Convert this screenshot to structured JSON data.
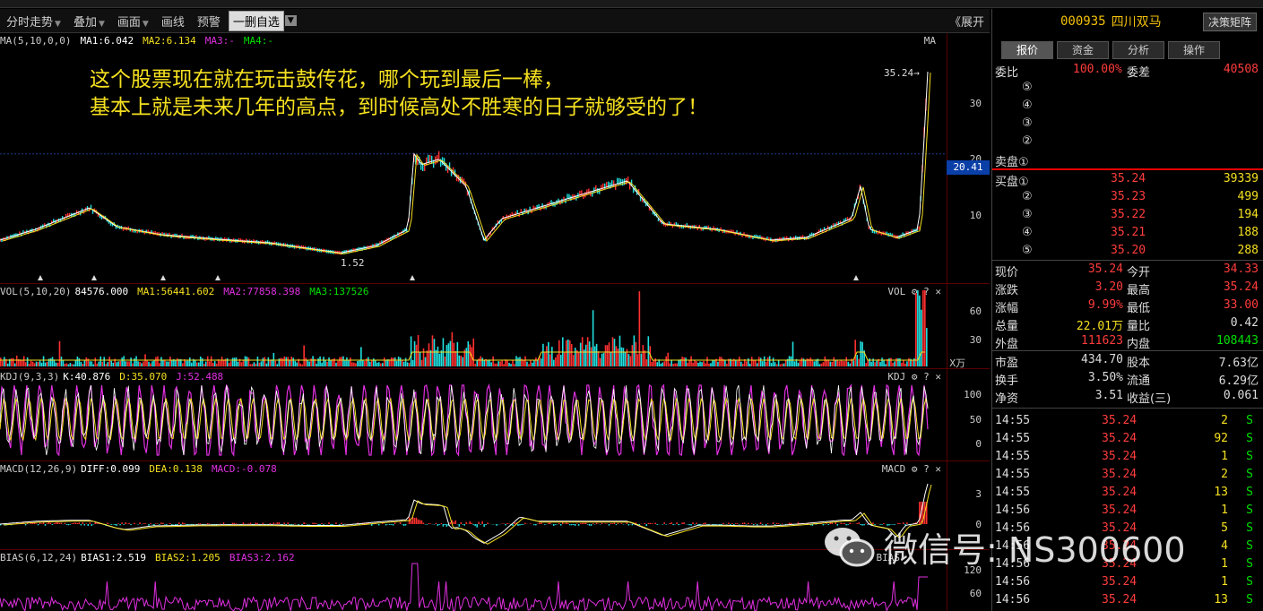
{
  "toolbar": {
    "items": [
      "分时走势",
      "叠加",
      "画面",
      "画线",
      "预警"
    ],
    "selected": "一删自选",
    "expand": "《展开"
  },
  "main_panel": {
    "title": "MA(5,10,0,0)",
    "ma1": "MA1:6.042",
    "ma2": "MA2:6.134",
    "ma3": "MA3:-",
    "ma4": "MA4:-",
    "corner": "MA",
    "high_label": "35.24→",
    "low_label": "1.52",
    "y_ticks": [
      "30",
      "20",
      "10"
    ],
    "current_price": "20.41"
  },
  "annotation": {
    "line1": "这个股票现在就在玩击鼓传花，哪个玩到最后一棒，",
    "line2": "基本上就是未来几年的高点，到时候高处不胜寒的日子就够受的了！"
  },
  "vol_panel": {
    "title": "VOL(5,10,20)",
    "v": "84576.000",
    "ma1": "MA1:56441.602",
    "ma2": "MA2:77858.398",
    "ma3": "MA3:137526",
    "corner": "VOL",
    "y_ticks": [
      "60",
      "30"
    ],
    "unit": "X万"
  },
  "kdj_panel": {
    "title": "KDJ(9,3,3)",
    "k": "K:40.876",
    "d": "D:35.070",
    "j": "J:52.488",
    "corner": "KDJ",
    "y_ticks": [
      "100",
      "50",
      "0"
    ]
  },
  "macd_panel": {
    "title": "MACD(12,26,9)",
    "diff": "DIFF:0.099",
    "dea": "DEA:0.138",
    "macd": "MACD:-0.078",
    "corner": "MACD",
    "y_ticks": [
      "3",
      "0"
    ]
  },
  "bias_panel": {
    "title": "BIAS(6,12,24)",
    "b1": "BIAS1:2.519",
    "b2": "BIAS2:1.205",
    "b3": "BIAS3:2.162",
    "corner": "BIAS",
    "y_ticks": [
      "120",
      "60"
    ]
  },
  "stock": {
    "code": "000935",
    "name": "四川双马",
    "decision_button": "决策矩阵",
    "tabs": [
      "报价",
      "资金",
      "分析",
      "操作"
    ],
    "wei_bi_label": "委比",
    "wei_bi": "100.00%",
    "wei_cha_label": "委差",
    "wei_cha": "40508",
    "sell_levels": [
      "⑤",
      "④",
      "③",
      "②",
      "卖盘①"
    ],
    "buy": [
      {
        "lvl": "买盘①",
        "price": "35.24",
        "vol": "39339"
      },
      {
        "lvl": "②",
        "price": "35.23",
        "vol": "499"
      },
      {
        "lvl": "③",
        "price": "35.22",
        "vol": "194"
      },
      {
        "lvl": "④",
        "price": "35.21",
        "vol": "188"
      },
      {
        "lvl": "⑤",
        "price": "35.20",
        "vol": "288"
      }
    ],
    "quotes": [
      {
        "l1": "现价",
        "v1": "35.24",
        "c1": "red",
        "l2": "今开",
        "v2": "34.33",
        "c2": "red"
      },
      {
        "l1": "涨跌",
        "v1": "3.20",
        "c1": "red",
        "l2": "最高",
        "v2": "35.24",
        "c2": "red"
      },
      {
        "l1": "涨幅",
        "v1": "9.99%",
        "c1": "red",
        "l2": "最低",
        "v2": "33.00",
        "c2": "red"
      },
      {
        "l1": "总量",
        "v1": "22.01万",
        "c1": "yel",
        "l2": "量比",
        "v2": "0.42",
        "c2": "wht"
      },
      {
        "l1": "外盘",
        "v1": "111623",
        "c1": "red",
        "l2": "内盘",
        "v2": "108443",
        "c2": "grn"
      }
    ],
    "fundamentals": [
      {
        "l1": "市盈",
        "v1": "434.70",
        "l2": "股本",
        "v2": "7.63亿"
      },
      {
        "l1": "换手",
        "v1": "3.50%",
        "l2": "流通",
        "v2": "6.29亿"
      },
      {
        "l1": "净资",
        "v1": "3.51",
        "l2": "收益(三)",
        "v2": "0.061"
      }
    ],
    "ticks": [
      {
        "t": "14:55",
        "p": "35.24",
        "v": "2",
        "s": "S"
      },
      {
        "t": "14:55",
        "p": "35.24",
        "v": "92",
        "s": "S"
      },
      {
        "t": "14:55",
        "p": "35.24",
        "v": "1",
        "s": "S"
      },
      {
        "t": "14:55",
        "p": "35.24",
        "v": "2",
        "s": "S"
      },
      {
        "t": "14:55",
        "p": "35.24",
        "v": "13",
        "s": "S"
      },
      {
        "t": "14:56",
        "p": "35.24",
        "v": "1",
        "s": "S"
      },
      {
        "t": "14:56",
        "p": "35.24",
        "v": "5",
        "s": "S"
      },
      {
        "t": "14:56",
        "p": "35.24",
        "v": "4",
        "s": "S"
      },
      {
        "t": "14:56",
        "p": "35.24",
        "v": "1",
        "s": "S"
      },
      {
        "t": "14:56",
        "p": "35.24",
        "v": "1",
        "s": "S"
      },
      {
        "t": "14:56",
        "p": "35.24",
        "v": "13",
        "s": "S"
      }
    ]
  },
  "watermark": "微信号: NS300600"
}
